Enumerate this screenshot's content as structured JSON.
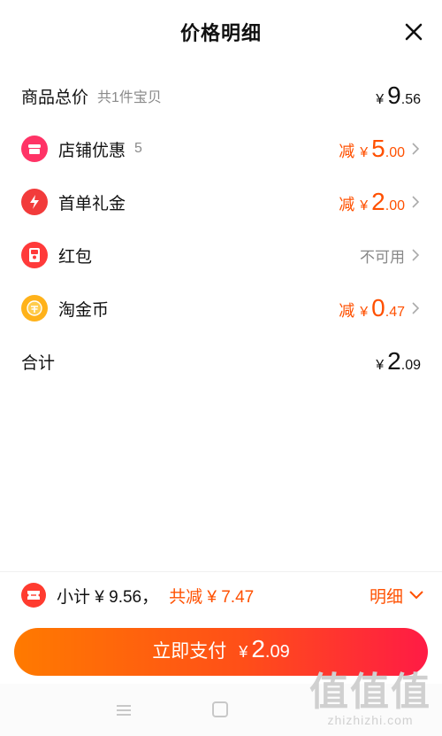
{
  "header": {
    "title": "价格明细"
  },
  "rows": [
    {
      "label": "商品总价",
      "sub": "共1件宝贝",
      "yen": "¥",
      "int": "9",
      "dec": ".56"
    },
    {
      "label": "店铺优惠",
      "sub": "5",
      "prefix": "减",
      "yen": "¥",
      "int": "5",
      "dec": ".00"
    },
    {
      "label": "首单礼金",
      "prefix": "减",
      "yen": "¥",
      "int": "2",
      "dec": ".00"
    },
    {
      "label": "红包",
      "value": "不可用"
    },
    {
      "label": "淘金币",
      "prefix": "减",
      "yen": "¥",
      "int": "0",
      "dec": ".47"
    },
    {
      "label": "合计",
      "yen": "¥",
      "int": "2",
      "dec": ".09"
    }
  ],
  "footer": {
    "subtotal": "小计 ¥ 9.56，",
    "savings": "共减 ¥ 7.47",
    "detail_label": "明细",
    "pay_label": "立即支付",
    "pay_yen": "¥",
    "pay_int": "2",
    "pay_dec": ".09"
  },
  "watermark": {
    "main": "值值值",
    "sub": "zhizhizhi.com"
  },
  "colors": {
    "accent": "#ff5000",
    "shop_icon": "#ff3366",
    "gift_icon": "#f23b3b",
    "redpacket_icon": "#ff3a3a",
    "coin_icon": "#ffb21a"
  }
}
